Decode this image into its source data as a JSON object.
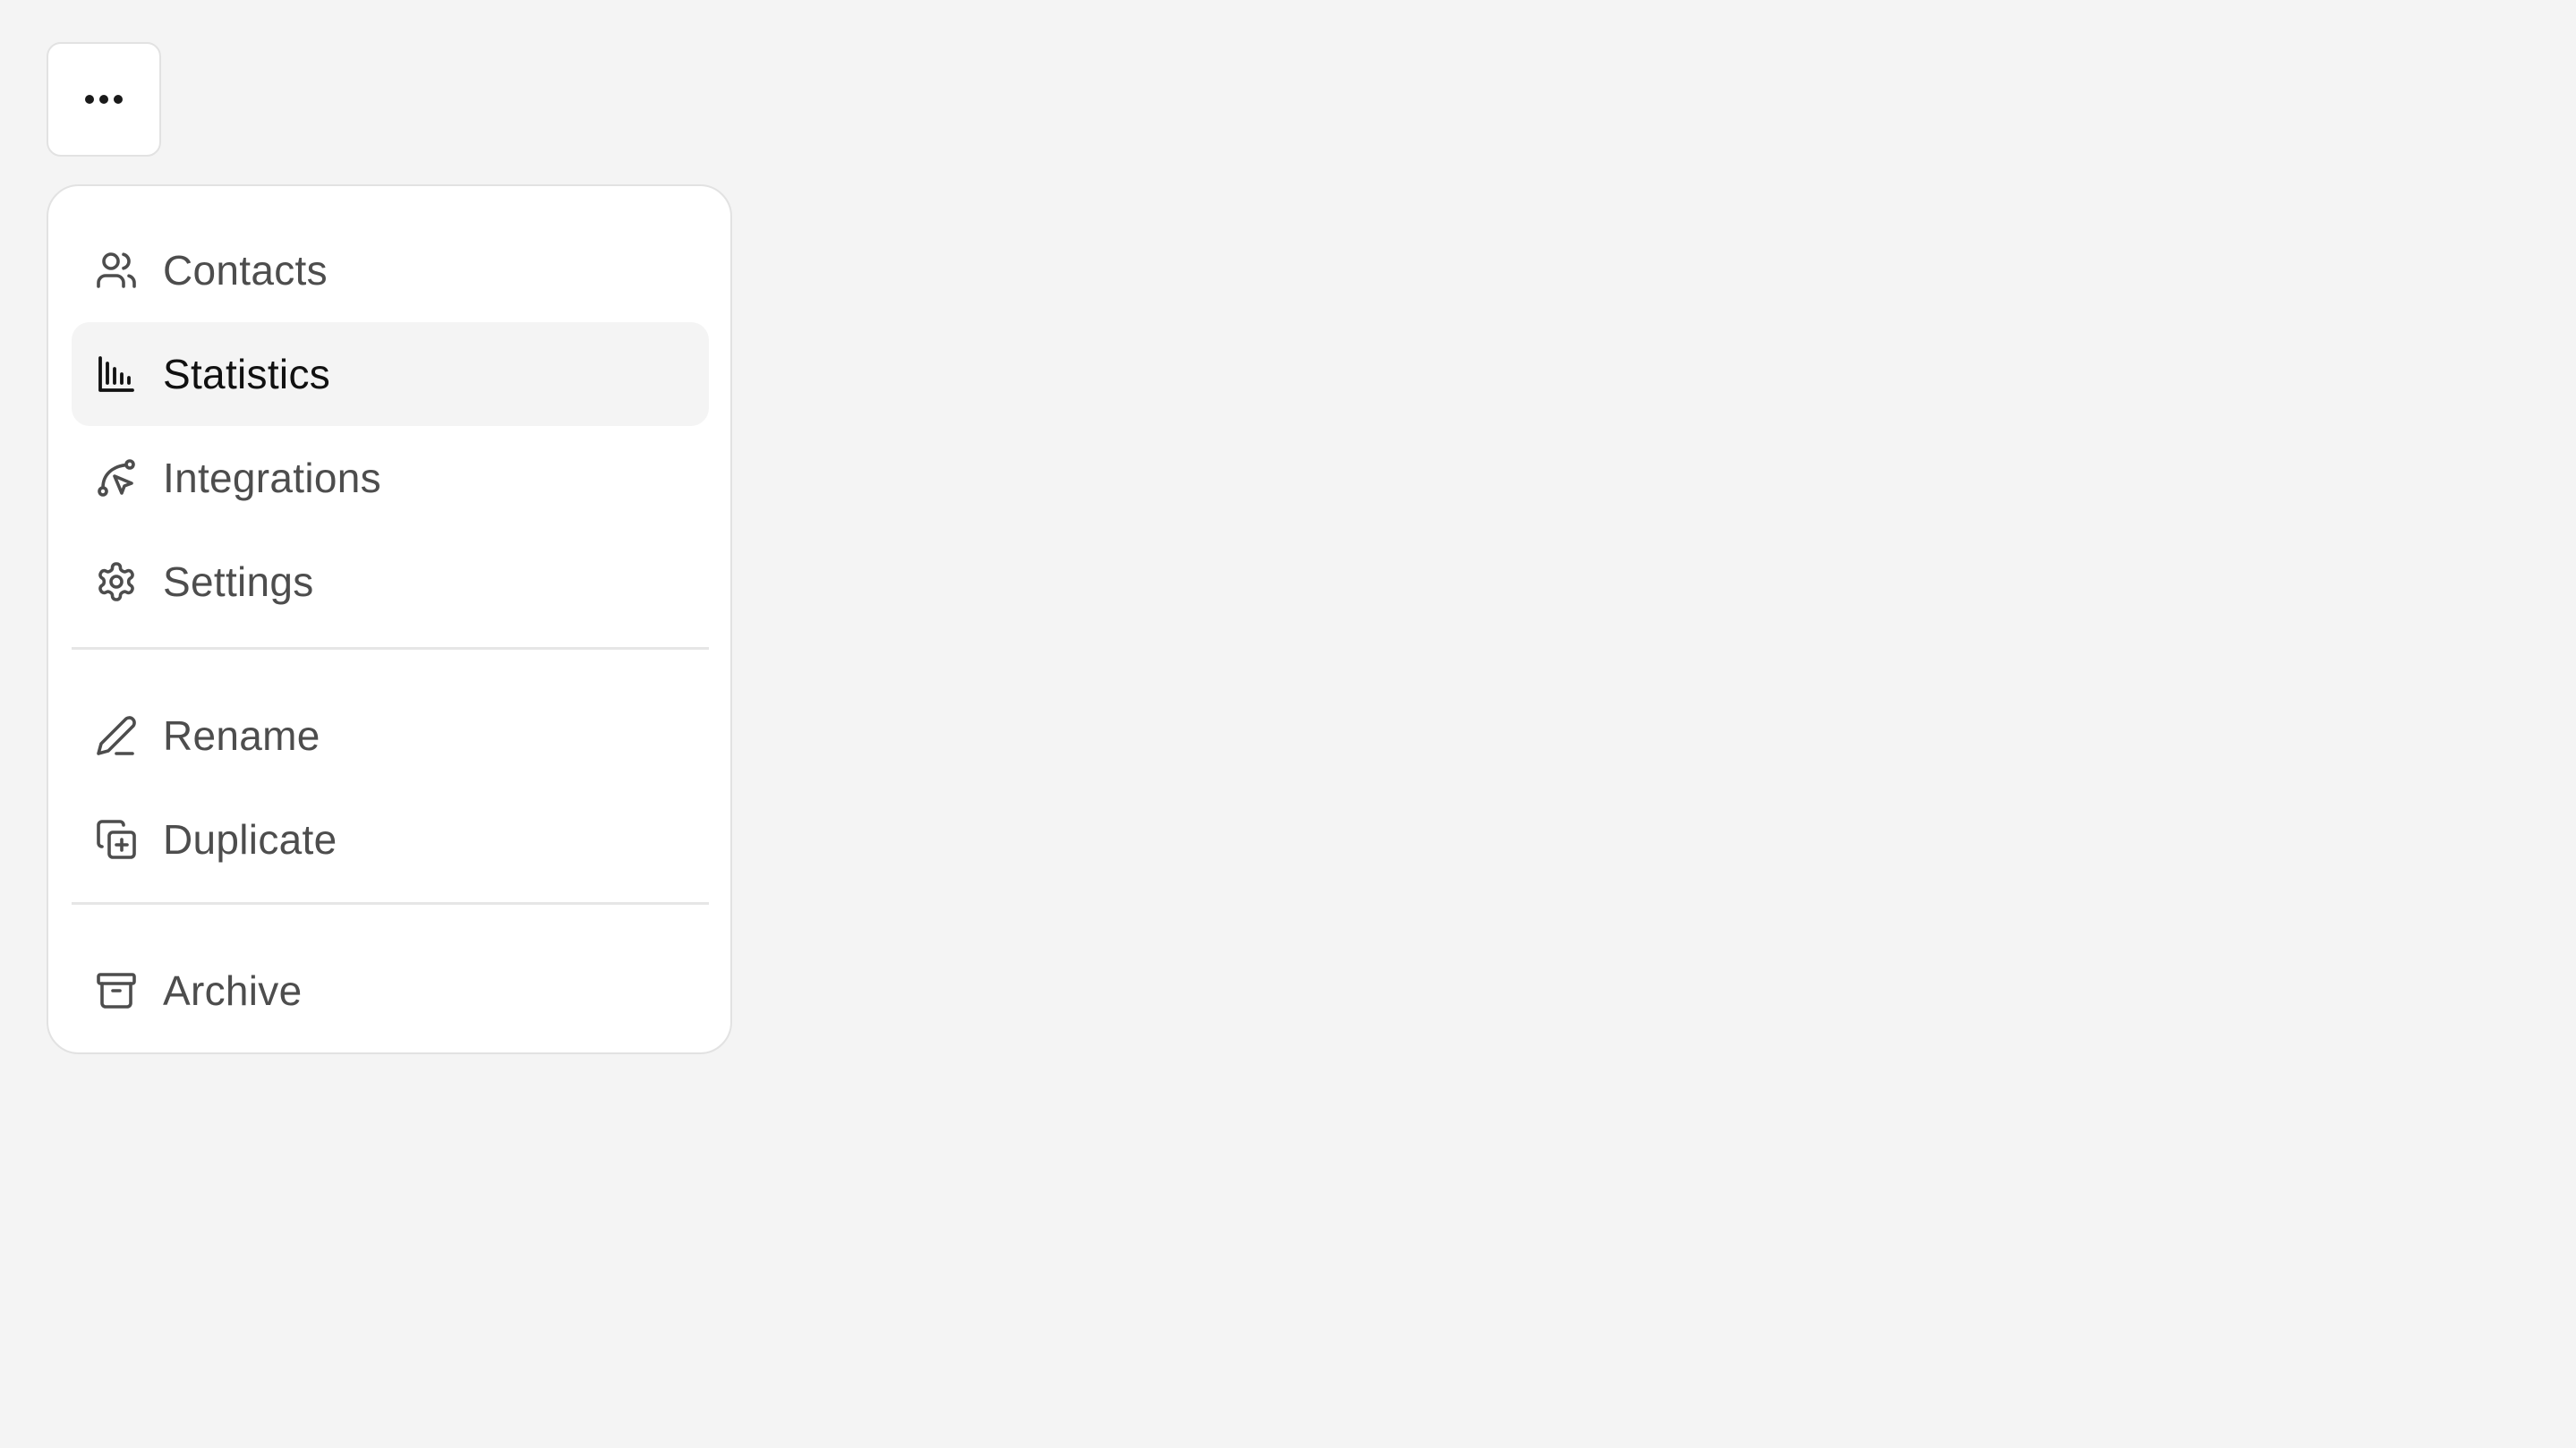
{
  "trigger": {
    "icon": "more-horizontal-icon"
  },
  "menu": {
    "groups": [
      {
        "items": [
          {
            "label": "Contacts",
            "icon": "users-icon",
            "active": false
          },
          {
            "label": "Statistics",
            "icon": "bar-chart-icon",
            "active": true
          },
          {
            "label": "Integrations",
            "icon": "route-cursor-icon",
            "active": false
          },
          {
            "label": "Settings",
            "icon": "gear-icon",
            "active": false
          }
        ]
      },
      {
        "items": [
          {
            "label": "Rename",
            "icon": "pencil-icon",
            "active": false
          },
          {
            "label": "Duplicate",
            "icon": "copy-plus-icon",
            "active": false
          }
        ]
      },
      {
        "items": [
          {
            "label": "Archive",
            "icon": "archive-icon",
            "active": false
          }
        ]
      }
    ]
  },
  "colors": {
    "background": "#f4f4f4",
    "surface": "#ffffff",
    "border": "#e2e2e2",
    "text": "#4d4d4d",
    "text_active": "#111111",
    "active_bg": "#f4f4f4"
  }
}
